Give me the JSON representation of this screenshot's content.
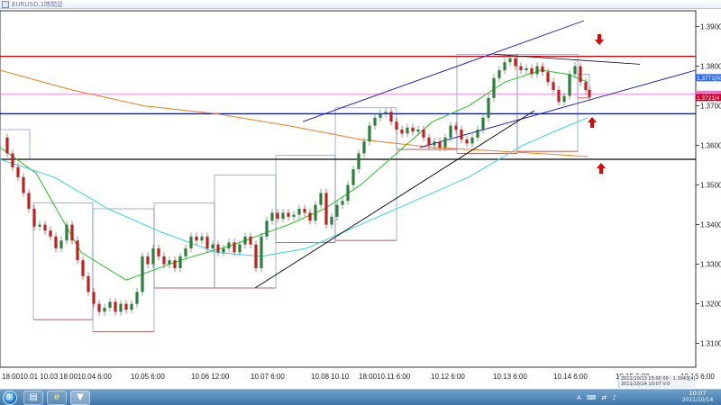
{
  "window": {
    "title": "EURUSD,1時間足"
  },
  "chart_data": {
    "type": "candlestick",
    "symbol": "EURUSD",
    "timeframe": "1 hour",
    "ylim": [
      1.304,
      1.394
    ],
    "price_ticks": [
      "1.3900[00",
      "1.3800[00",
      "1.3700[00",
      "1.3600[00",
      "1.3500[00",
      "1.3400[00",
      "1.3300[00",
      "1.3200[00",
      "1.3100[00"
    ],
    "time_ticks": [
      "18:0010.01 10.03",
      "18:0010.04 6:00",
      "10.05 6:00",
      "10.06 12:00",
      "10.07 6:00",
      "10.08 10.10",
      "18:0010.11 6:00",
      "10.12 6:00",
      "10.13 6:00",
      "10.14 6:00",
      "10.15 6:00",
      "10.16 6:00"
    ],
    "price_labels": [
      {
        "text": "1.3771[00",
        "price": 1.3771,
        "bg": "#2b6cff",
        "color": "#ffffff"
      },
      {
        "text": "1.3728[4",
        "price": 1.3729,
        "bg": "#ff66cc",
        "color": "#ffffff"
      },
      {
        "text": "1.3721[4",
        "price": 1.3721,
        "bg": "#d0002a",
        "color": "#ffffff"
      }
    ],
    "horizontal_lines": [
      {
        "price": 1.3825,
        "color": "#e00000"
      },
      {
        "price": 1.373,
        "color": "#ff77dd"
      },
      {
        "price": 1.368,
        "color": "#0010c0"
      },
      {
        "price": 1.3565,
        "color": "#000000"
      }
    ],
    "status": {
      "line1": "2011/10/13 15:00 00 : 1.3043[4]",
      "line2": "2011/10/14 10:07 V:0"
    },
    "moving_averages": [
      {
        "color": "#f07b1a"
      },
      {
        "color": "#21c421"
      },
      {
        "color": "#33d6e0"
      }
    ]
  },
  "taskbar": {
    "start_glyph": "⊞",
    "apps": [
      {
        "name": "explorer",
        "glyph": "▤"
      },
      {
        "name": "internet-explorer",
        "glyph": "e"
      },
      {
        "name": "metatrader",
        "glyph": "▼"
      }
    ],
    "tray_items": [
      "A",
      "⌨",
      "⇄",
      "♪"
    ],
    "time": "10:07",
    "date": "2011/10/14"
  }
}
